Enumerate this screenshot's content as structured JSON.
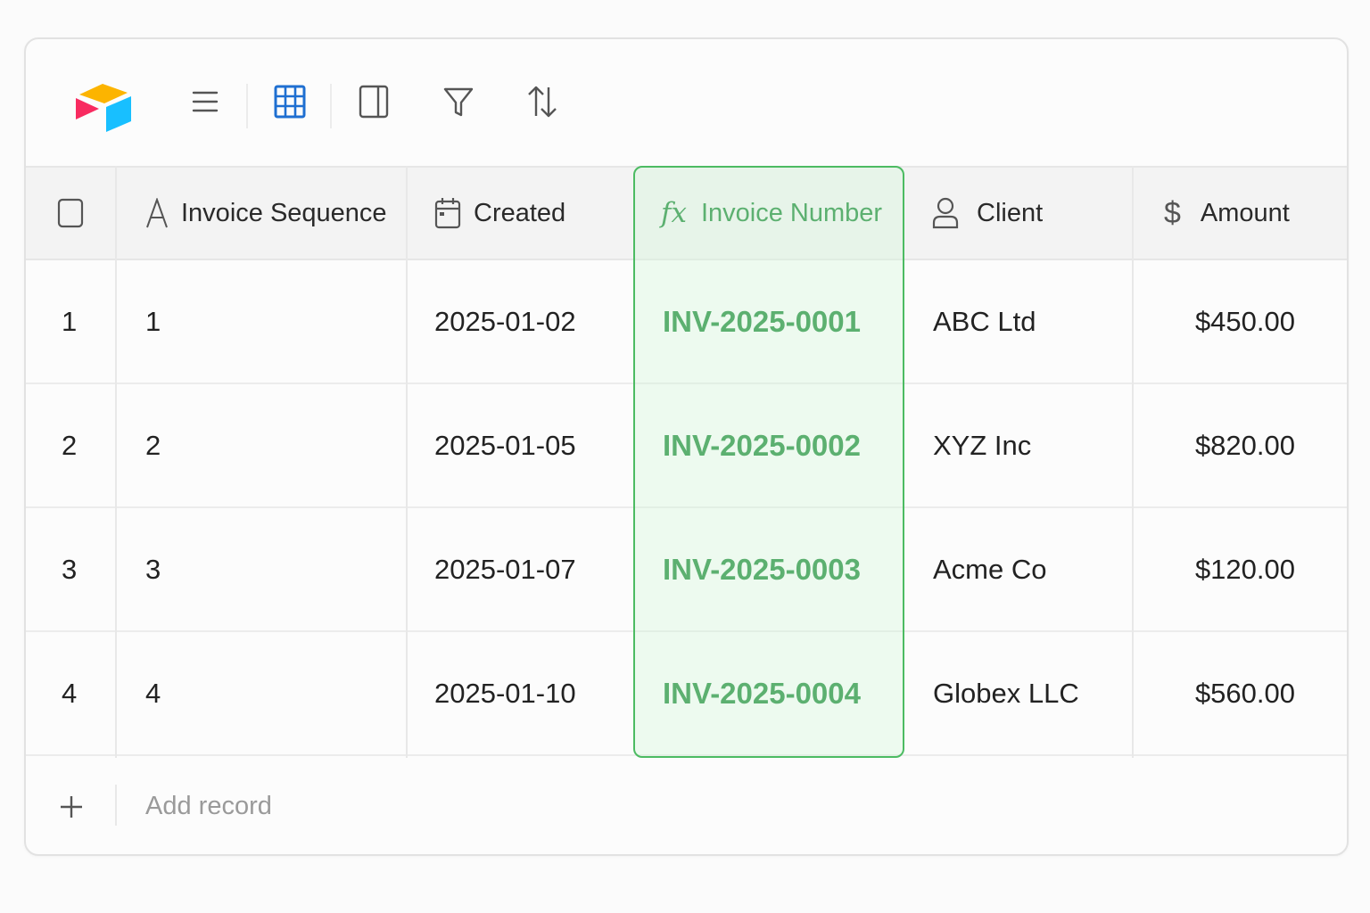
{
  "toolbar": {
    "icons": [
      "app-logo",
      "menu-icon",
      "grid-view-icon",
      "sidebar-panel-icon",
      "filter-icon",
      "sort-icon"
    ],
    "active_icon_color": "#1f6fd1"
  },
  "columns": [
    {
      "label": "Invoice Sequence",
      "icon": "text-field-icon"
    },
    {
      "label": "Created",
      "icon": "calendar-icon"
    },
    {
      "label": "Invoice Number",
      "icon": "formula-icon",
      "icon_text": "fx"
    },
    {
      "label": "Client",
      "icon": "user-icon"
    },
    {
      "label": "Amount",
      "icon": "dollar-icon",
      "icon_text": "$"
    }
  ],
  "rows": [
    {
      "num": "1",
      "sequence": "1",
      "created": "2025-01-02",
      "invoice": "INV-2025-0001",
      "client": "ABC Ltd",
      "amount": "$450.00"
    },
    {
      "num": "2",
      "sequence": "2",
      "created": "2025-01-05",
      "invoice": "INV-2025-0002",
      "client": "XYZ Inc",
      "amount": "$820.00"
    },
    {
      "num": "3",
      "sequence": "3",
      "created": "2025-01-07",
      "invoice": "INV-2025-0003",
      "client": "Acme Co",
      "amount": "$120.00"
    },
    {
      "num": "4",
      "sequence": "4",
      "created": "2025-01-10",
      "invoice": "INV-2025-0004",
      "client": "Globex LLC",
      "amount": "$560.00"
    }
  ],
  "add_record": {
    "icon": "plus-icon",
    "label": "Add record"
  },
  "colors": {
    "formula_accent": "#1e8a3a",
    "formula_border": "#4cbb62",
    "header_bg": "#f3f3f3"
  }
}
